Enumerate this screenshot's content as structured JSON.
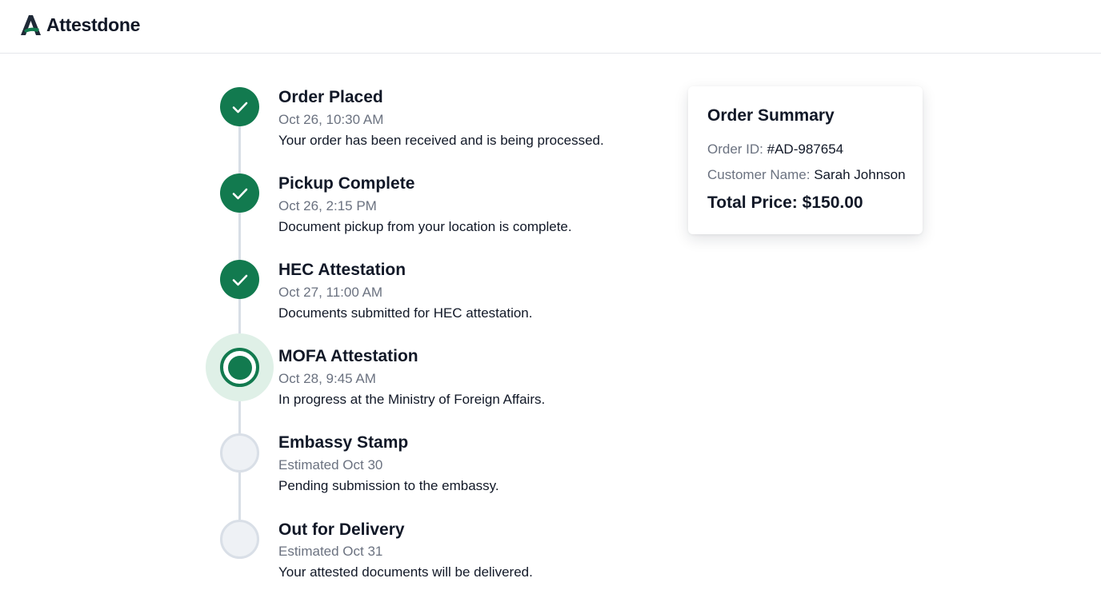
{
  "brand": {
    "name": "Attestdone",
    "accent": "#127a4f"
  },
  "timeline": {
    "steps": [
      {
        "title": "Order Placed",
        "time": "Oct 26, 10:30 AM",
        "desc": "Your order has been received and is being processed.",
        "status": "done"
      },
      {
        "title": "Pickup Complete",
        "time": "Oct 26, 2:15 PM",
        "desc": "Document pickup from your location is complete.",
        "status": "done"
      },
      {
        "title": "HEC Attestation",
        "time": "Oct 27, 11:00 AM",
        "desc": "Documents submitted for HEC attestation.",
        "status": "done"
      },
      {
        "title": "MOFA Attestation",
        "time": "Oct 28, 9:45 AM",
        "desc": "In progress at the Ministry of Foreign Affairs.",
        "status": "active"
      },
      {
        "title": "Embassy Stamp",
        "time": "Estimated Oct 30",
        "desc": "Pending submission to the embassy.",
        "status": "pending"
      },
      {
        "title": "Out for Delivery",
        "time": "Estimated Oct 31",
        "desc": "Your attested documents will be delivered.",
        "status": "pending"
      }
    ]
  },
  "summary": {
    "title": "Order Summary",
    "order_id_label": "Order ID:",
    "order_id": "#AD-987654",
    "customer_label": "Customer Name:",
    "customer": "Sarah Johnson",
    "total_label": "Total Price:",
    "total": "$150.00"
  }
}
